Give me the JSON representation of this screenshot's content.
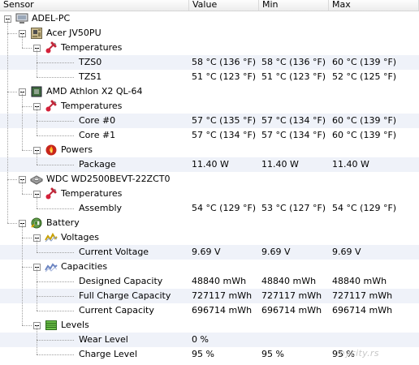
{
  "columns": {
    "sensor": "Sensor",
    "value": "Value",
    "min": "Min",
    "max": "Max"
  },
  "root": "ADEL-PC",
  "devices": [
    {
      "name": "Acer JV50PU",
      "icon": "motherboard-icon",
      "groups": [
        {
          "name": "Temperatures",
          "icon": "thermometer-icon",
          "sensors": [
            {
              "name": "TZS0",
              "value": "58 °C  (136 °F)",
              "min": "58 °C  (136 °F)",
              "max": "60 °C  (139 °F)"
            },
            {
              "name": "TZS1",
              "value": "51 °C  (123 °F)",
              "min": "51 °C  (123 °F)",
              "max": "52 °C  (125 °F)"
            }
          ]
        }
      ]
    },
    {
      "name": "AMD Athlon X2 QL-64",
      "icon": "cpu-icon",
      "groups": [
        {
          "name": "Temperatures",
          "icon": "thermometer-icon",
          "sensors": [
            {
              "name": "Core #0",
              "value": "57 °C  (135 °F)",
              "min": "57 °C  (134 °F)",
              "max": "60 °C  (139 °F)"
            },
            {
              "name": "Core #1",
              "value": "57 °C  (134 °F)",
              "min": "57 °C  (134 °F)",
              "max": "60 °C  (139 °F)"
            }
          ]
        },
        {
          "name": "Powers",
          "icon": "fire-icon",
          "sensors": [
            {
              "name": "Package",
              "value": "11.40 W",
              "min": "11.40 W",
              "max": "11.40 W"
            }
          ]
        }
      ]
    },
    {
      "name": "WDC WD2500BEVT-22ZCT0",
      "icon": "hard-drive-icon",
      "groups": [
        {
          "name": "Temperatures",
          "icon": "thermometer-icon",
          "sensors": [
            {
              "name": "Assembly",
              "value": "54 °C  (129 °F)",
              "min": "53 °C  (127 °F)",
              "max": "54 °C  (129 °F)"
            }
          ]
        }
      ]
    },
    {
      "name": "Battery",
      "icon": "battery-icon",
      "groups": [
        {
          "name": "Voltages",
          "icon": "voltage-icon",
          "sensors": [
            {
              "name": "Current Voltage",
              "value": "9.69 V",
              "min": "9.69 V",
              "max": "9.69 V"
            }
          ]
        },
        {
          "name": "Capacities",
          "icon": "capacity-icon",
          "sensors": [
            {
              "name": "Designed Capacity",
              "value": "48840 mWh",
              "min": "48840 mWh",
              "max": "48840 mWh"
            },
            {
              "name": "Full Charge Capacity",
              "value": "727117 mWh",
              "min": "727117 mWh",
              "max": "727117 mWh"
            },
            {
              "name": "Current Capacity",
              "value": "696714 mWh",
              "min": "696714 mWh",
              "max": "696714 mWh"
            }
          ]
        },
        {
          "name": "Levels",
          "icon": "levels-icon",
          "sensors": [
            {
              "name": "Wear Level",
              "value": "0 %",
              "min": "",
              "max": ""
            },
            {
              "name": "Charge Level",
              "value": "95 %",
              "min": "95 %",
              "max": "95 %"
            }
          ]
        }
      ]
    }
  ],
  "watermark": "mycity.rs"
}
